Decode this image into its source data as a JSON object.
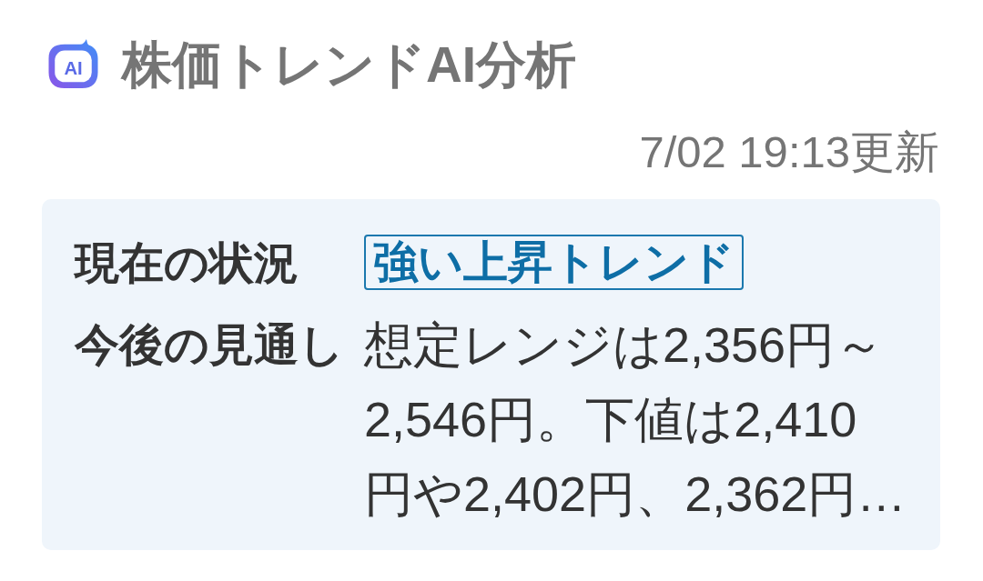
{
  "header": {
    "logo_text": "AI",
    "title": "株価トレンドAI分析"
  },
  "updated": "7/02 19:13更新",
  "analysis": {
    "rows": [
      {
        "kind": "badge",
        "label": "現在の状況",
        "value": "強い上昇トレンド"
      },
      {
        "kind": "text",
        "label": "今後の見通し",
        "value": "想定レンジは2,356円～2,546円。下値は2,410円や2,402円、2,362円…"
      }
    ]
  }
}
